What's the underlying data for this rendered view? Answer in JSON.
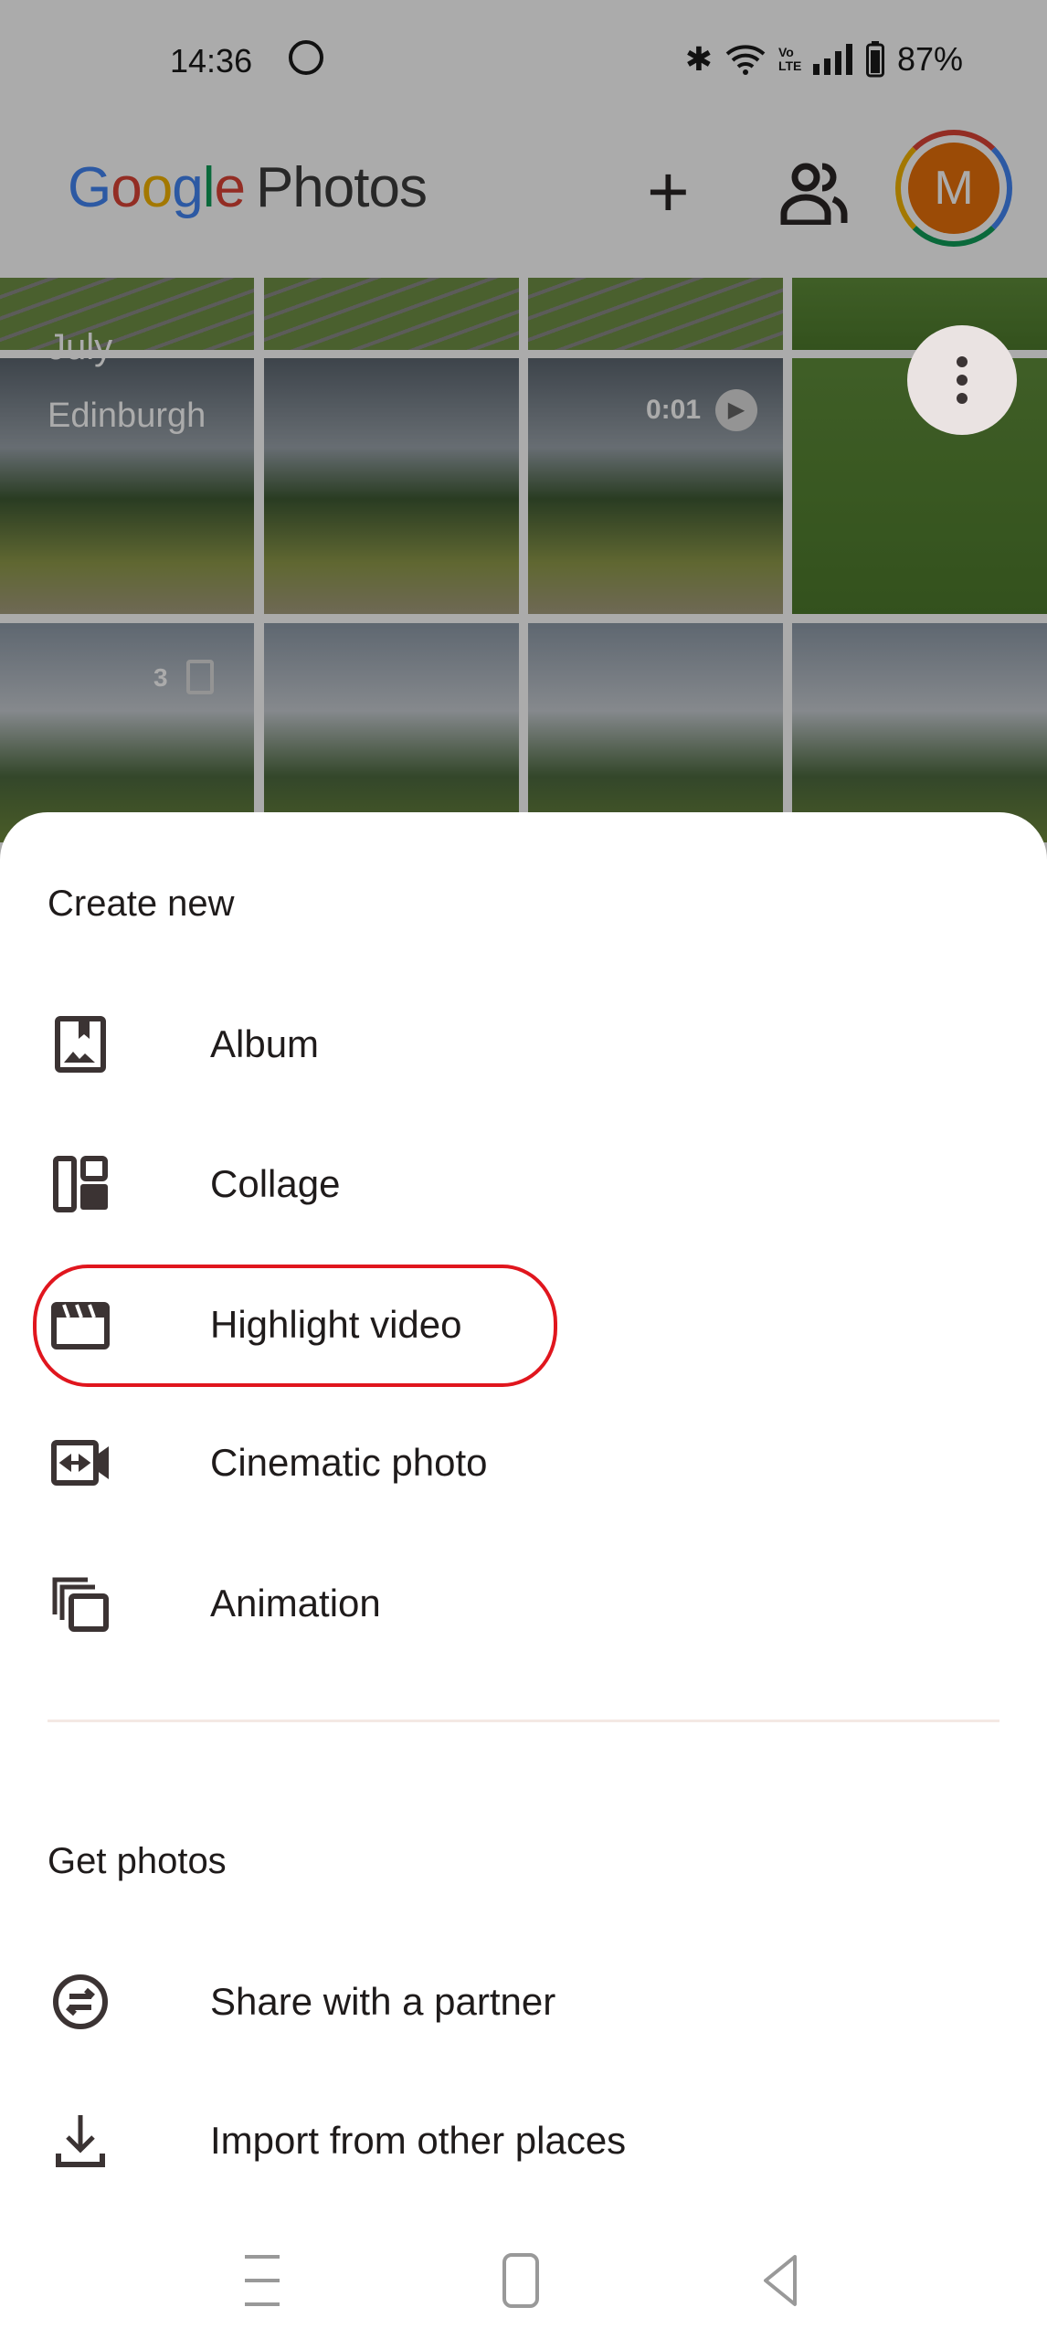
{
  "status_bar": {
    "time": "14:36",
    "battery": "87%",
    "network_label": "Vo LTE"
  },
  "app_bar": {
    "logo_google": "Google",
    "logo_photos": "Photos",
    "avatar_initial": "M"
  },
  "grid": {
    "month_label": "July",
    "location_label": "Edinburgh",
    "video_duration": "0:01",
    "burst_count": "3"
  },
  "sheet": {
    "create_heading": "Create new",
    "create_items": [
      {
        "label": "Album",
        "icon": "album-icon"
      },
      {
        "label": "Collage",
        "icon": "collage-icon"
      },
      {
        "label": "Highlight video",
        "icon": "clapperboard-icon",
        "highlighted": true
      },
      {
        "label": "Cinematic photo",
        "icon": "cinematic-icon"
      },
      {
        "label": "Animation",
        "icon": "animation-icon"
      }
    ],
    "get_heading": "Get photos",
    "get_items": [
      {
        "label": "Share with a partner",
        "icon": "partner-share-icon"
      },
      {
        "label": "Import from other places",
        "icon": "download-icon"
      }
    ]
  },
  "colors": {
    "annotation": "#e0161e",
    "avatar": "#e8710a"
  }
}
